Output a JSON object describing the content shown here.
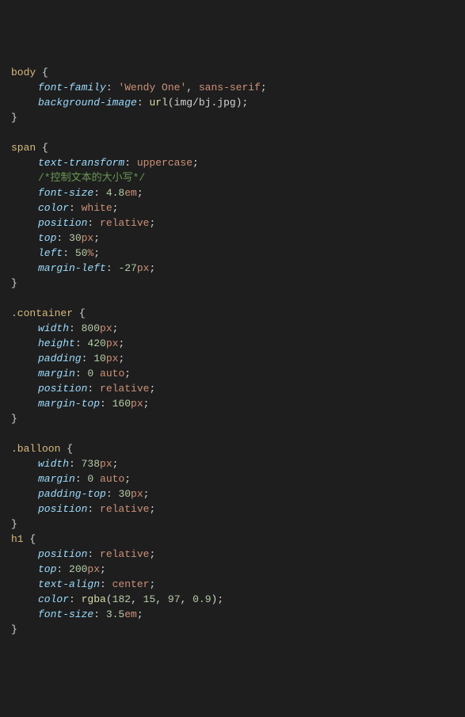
{
  "rules": [
    {
      "selector": "body",
      "decls": [
        {
          "prop": "font-family",
          "parts": [
            {
              "t": "str",
              "v": "'Wendy One'"
            },
            {
              "t": "punc",
              "v": ", "
            },
            {
              "t": "val",
              "v": "sans-serif"
            }
          ]
        },
        {
          "prop": "background-image",
          "parts": [
            {
              "t": "fn",
              "v": "url"
            },
            {
              "t": "punc",
              "v": "("
            },
            {
              "t": "inurl",
              "v": "img/bj.jpg"
            },
            {
              "t": "punc",
              "v": ")"
            }
          ]
        }
      ]
    },
    {
      "selector": "span",
      "decls": [
        {
          "prop": "text-transform",
          "parts": [
            {
              "t": "val",
              "v": "uppercase"
            }
          ]
        },
        {
          "comment": "/*控制文本的大小写*/"
        },
        {
          "prop": "font-size",
          "parts": [
            {
              "t": "num",
              "v": "4.8"
            },
            {
              "t": "unit",
              "v": "em"
            }
          ]
        },
        {
          "prop": "color",
          "parts": [
            {
              "t": "val",
              "v": "white"
            }
          ]
        },
        {
          "prop": "position",
          "parts": [
            {
              "t": "val",
              "v": "relative"
            }
          ]
        },
        {
          "prop": "top",
          "parts": [
            {
              "t": "num",
              "v": "30"
            },
            {
              "t": "unit",
              "v": "px"
            }
          ]
        },
        {
          "prop": "left",
          "parts": [
            {
              "t": "num",
              "v": "50"
            },
            {
              "t": "unit",
              "v": "%"
            }
          ]
        },
        {
          "prop": "margin-left",
          "parts": [
            {
              "t": "num",
              "v": "-27"
            },
            {
              "t": "unit",
              "v": "px"
            }
          ]
        }
      ]
    },
    {
      "selector": ".container",
      "decls": [
        {
          "prop": "width",
          "parts": [
            {
              "t": "num",
              "v": "800"
            },
            {
              "t": "unit",
              "v": "px"
            }
          ]
        },
        {
          "prop": "height",
          "parts": [
            {
              "t": "num",
              "v": "420"
            },
            {
              "t": "unit",
              "v": "px"
            }
          ]
        },
        {
          "prop": "padding",
          "parts": [
            {
              "t": "num",
              "v": "10"
            },
            {
              "t": "unit",
              "v": "px"
            }
          ]
        },
        {
          "prop": "margin",
          "parts": [
            {
              "t": "num",
              "v": "0"
            },
            {
              "t": "punc",
              "v": " "
            },
            {
              "t": "val",
              "v": "auto"
            }
          ]
        },
        {
          "prop": "position",
          "parts": [
            {
              "t": "val",
              "v": "relative"
            }
          ]
        },
        {
          "prop": "margin-top",
          "parts": [
            {
              "t": "num",
              "v": "160"
            },
            {
              "t": "unit",
              "v": "px"
            }
          ]
        }
      ]
    },
    {
      "selector": ".balloon",
      "decls": [
        {
          "prop": "width",
          "parts": [
            {
              "t": "num",
              "v": "738"
            },
            {
              "t": "unit",
              "v": "px"
            }
          ]
        },
        {
          "prop": "margin",
          "parts": [
            {
              "t": "num",
              "v": "0"
            },
            {
              "t": "punc",
              "v": " "
            },
            {
              "t": "val",
              "v": "auto"
            }
          ]
        },
        {
          "prop": "padding-top",
          "parts": [
            {
              "t": "num",
              "v": "30"
            },
            {
              "t": "unit",
              "v": "px"
            }
          ]
        },
        {
          "prop": "position",
          "parts": [
            {
              "t": "val",
              "v": "relative"
            }
          ]
        }
      ]
    },
    {
      "selector": "h1",
      "decls": [
        {
          "prop": "position",
          "parts": [
            {
              "t": "val",
              "v": "relative"
            }
          ]
        },
        {
          "prop": "top",
          "parts": [
            {
              "t": "num",
              "v": "200"
            },
            {
              "t": "unit",
              "v": "px"
            }
          ]
        },
        {
          "prop": "text-align",
          "parts": [
            {
              "t": "val",
              "v": "center"
            }
          ]
        },
        {
          "prop": "color",
          "parts": [
            {
              "t": "fn",
              "v": "rgba"
            },
            {
              "t": "punc",
              "v": "("
            },
            {
              "t": "num",
              "v": "182"
            },
            {
              "t": "punc",
              "v": ", "
            },
            {
              "t": "num",
              "v": "15"
            },
            {
              "t": "punc",
              "v": ", "
            },
            {
              "t": "num",
              "v": "97"
            },
            {
              "t": "punc",
              "v": ", "
            },
            {
              "t": "num",
              "v": "0.9"
            },
            {
              "t": "punc",
              "v": ")"
            }
          ]
        },
        {
          "prop": "font-size",
          "parts": [
            {
              "t": "num",
              "v": "3.5"
            },
            {
              "t": "unit",
              "v": "em"
            }
          ]
        }
      ]
    }
  ],
  "blank_after": {
    "0": true,
    "1": true,
    "2": true,
    "3": false
  },
  "no_blank_before": {
    "4": true
  }
}
